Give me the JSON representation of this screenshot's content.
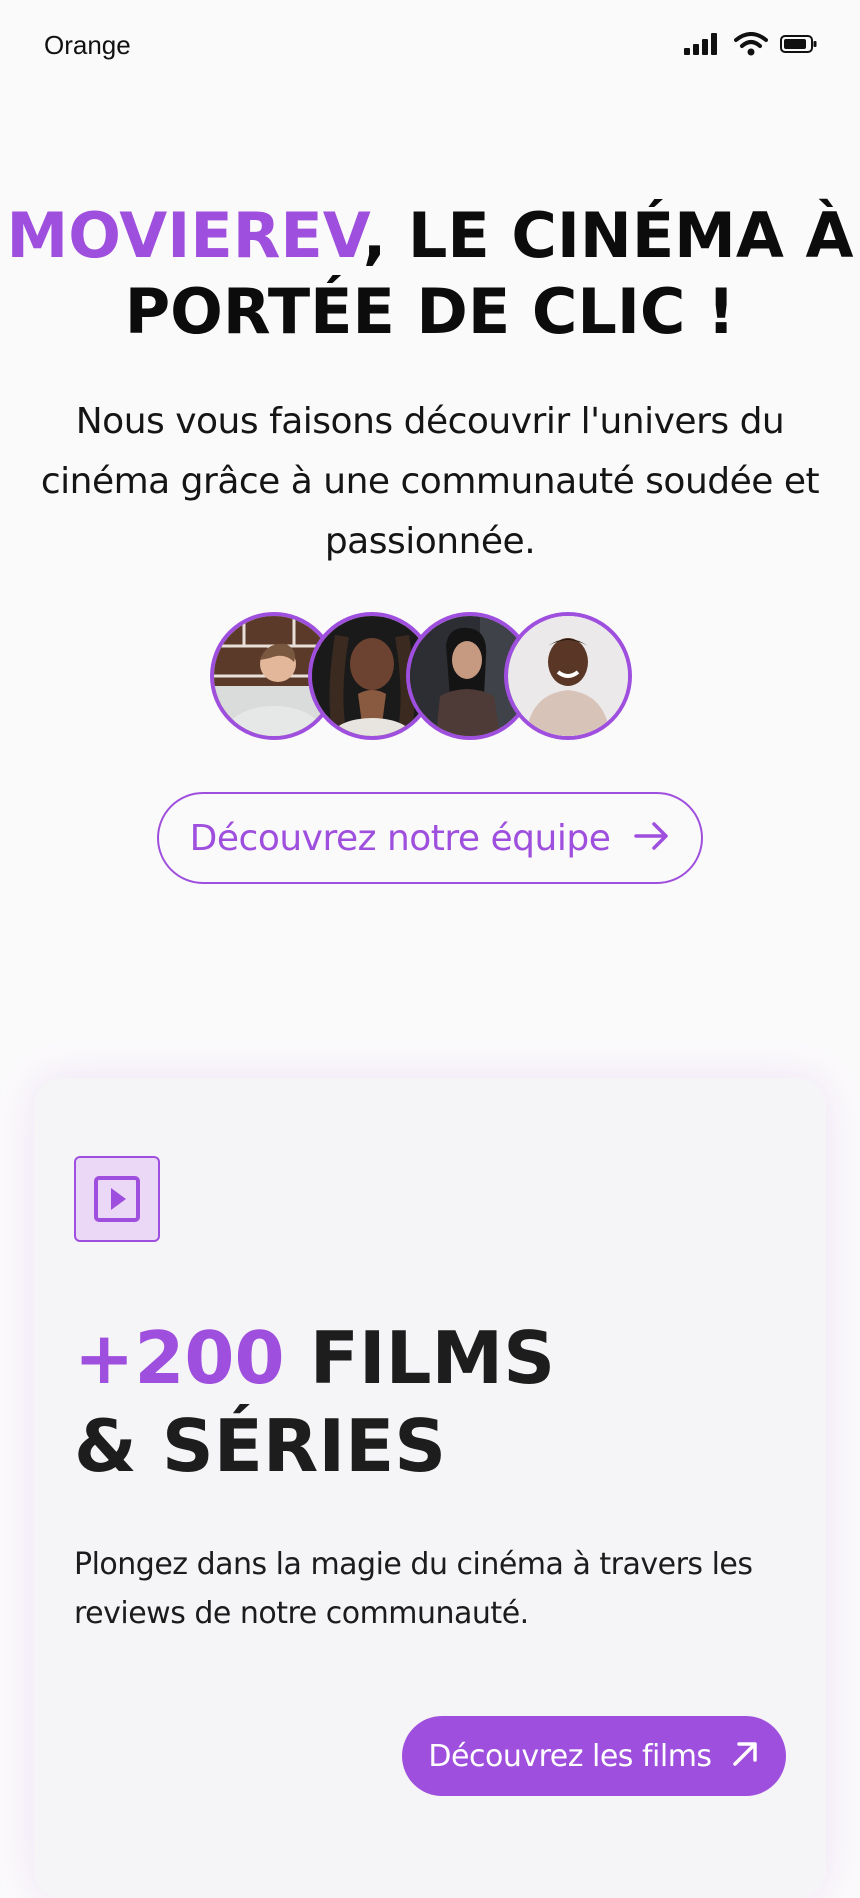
{
  "status_bar": {
    "carrier": "Orange",
    "icons": [
      "signal-icon",
      "wifi-icon",
      "battery-icon"
    ]
  },
  "hero": {
    "title_brand": "MOVIEREV",
    "title_line1_rest": ", LE CINÉMA À",
    "title_line2": "PORTÉE DE CLIC !",
    "subtitle": "Nous vous faisons découvrir l'univers du cinéma grâce à une communauté soudée et passionnée.",
    "team_button_label": "Découvrez notre équipe"
  },
  "card": {
    "icon": "play-icon",
    "title_accent": "+200",
    "title_rest": " FILMS",
    "title_line2": "& SÉRIES",
    "description": "Plongez dans la magie du cinéma à travers les reviews de notre communauté.",
    "button_label": "Découvrez les films"
  },
  "colors": {
    "accent": "#9f4fdd",
    "background": "#fbfafb",
    "card_background": "#f5f4f6",
    "text": "#111111"
  }
}
